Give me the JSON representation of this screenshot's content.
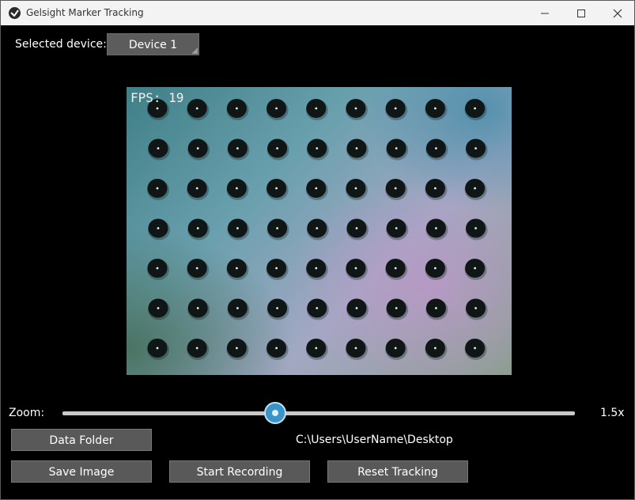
{
  "window": {
    "title": "Gelsight Marker Tracking"
  },
  "device": {
    "label": "Selected device:",
    "selected": "Device 1"
  },
  "camera": {
    "fps_text": "FPS: 19",
    "marker_rows": 7,
    "marker_cols": 9
  },
  "zoom": {
    "label": "Zoom:",
    "value_text": "1.5x",
    "slider_fraction": 0.41
  },
  "folder": {
    "button": "Data Folder",
    "path": "C:\\Users\\UserName\\Desktop"
  },
  "actions": {
    "save": "Save Image",
    "record": "Start Recording",
    "reset": "Reset Tracking"
  },
  "colors": {
    "slider_thumb": "#3a93c9",
    "button": "#595959"
  }
}
